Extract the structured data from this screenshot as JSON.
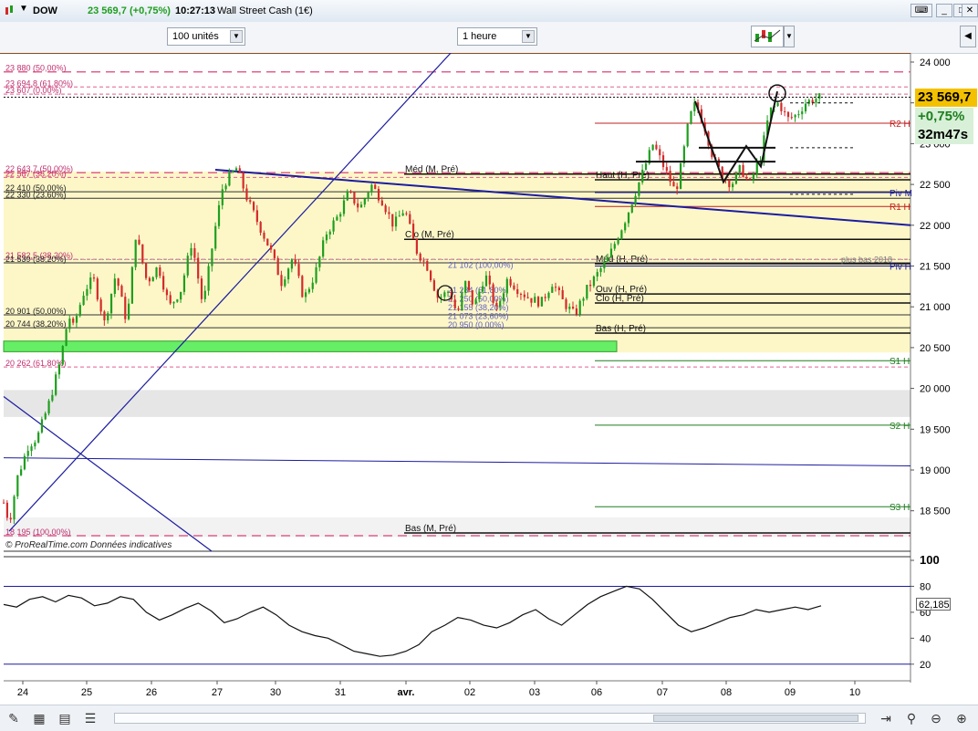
{
  "window": {
    "symbol": "DOW",
    "price": "23 569,7",
    "change": "(+0,75%)",
    "time": "10:27:13",
    "name": "Wall Street Cash (1€)"
  },
  "toolbar": {
    "units": "100 unités",
    "timeframe": "1 heure"
  },
  "badges": {
    "price": "23 569,7",
    "change": "+0,75%",
    "countdown": "32m47s"
  },
  "footer_note": "© ProRealTime.com  Données indicatives",
  "rsi_value": "62,185",
  "colors": {
    "up": "#1e9e1e",
    "down": "#d32a2a",
    "fib": "#e06090",
    "zone": "#fdf7c8",
    "trend": "#1c1ca0",
    "green_zone": "#66ee66"
  },
  "chart_data": [
    {
      "type": "candlestick",
      "title": "",
      "xlabel": "",
      "ylabel": "",
      "ylim": [
        18000,
        24200
      ],
      "grid": false,
      "x_tick_labels": [
        "24",
        "25",
        "26",
        "27",
        "30",
        "31",
        "avr.",
        "02",
        "03",
        "06",
        "07",
        "08",
        "09",
        "10"
      ],
      "y_tick_labels": [
        "24 000",
        "23 500",
        "23 000",
        "22 500",
        "22 000",
        "21 500",
        "21 000",
        "20 500",
        "20 000",
        "19 500",
        "19 000",
        "18 500"
      ],
      "y_ticks": [
        24000,
        23500,
        23000,
        22500,
        22000,
        21500,
        21000,
        20500,
        20000,
        19500,
        19000,
        18500
      ],
      "last_price": 23569.7,
      "path": [
        [
          0,
          18600
        ],
        [
          5,
          18350
        ],
        [
          12,
          18900
        ],
        [
          22,
          19300
        ],
        [
          30,
          19400
        ],
        [
          40,
          19800
        ],
        [
          50,
          20300
        ],
        [
          58,
          20900
        ],
        [
          62,
          20750
        ],
        [
          72,
          21200
        ],
        [
          80,
          21350
        ],
        [
          90,
          20800
        ],
        [
          100,
          21400
        ],
        [
          110,
          20800
        ],
        [
          118,
          21900
        ],
        [
          128,
          21300
        ],
        [
          138,
          21500
        ],
        [
          148,
          21000
        ],
        [
          158,
          21200
        ],
        [
          168,
          21800
        ],
        [
          178,
          21000
        ],
        [
          188,
          21900
        ],
        [
          196,
          22500
        ],
        [
          208,
          22700
        ],
        [
          218,
          22300
        ],
        [
          228,
          22000
        ],
        [
          238,
          21700
        ],
        [
          248,
          21300
        ],
        [
          258,
          21600
        ],
        [
          268,
          21100
        ],
        [
          278,
          21400
        ],
        [
          288,
          21900
        ],
        [
          298,
          22100
        ],
        [
          308,
          22400
        ],
        [
          318,
          22200
        ],
        [
          328,
          22500
        ],
        [
          338,
          22300
        ],
        [
          348,
          22000
        ],
        [
          358,
          22200
        ],
        [
          368,
          21700
        ],
        [
          378,
          21500
        ],
        [
          388,
          21100
        ],
        [
          398,
          21200
        ],
        [
          405,
          20900
        ],
        [
          412,
          21300
        ],
        [
          420,
          21000
        ],
        [
          430,
          21400
        ],
        [
          440,
          20950
        ],
        [
          450,
          21350
        ],
        [
          460,
          21200
        ],
        [
          470,
          21100
        ],
        [
          480,
          21050
        ],
        [
          490,
          21300
        ],
        [
          500,
          21050
        ],
        [
          510,
          20900
        ],
        [
          520,
          21200
        ],
        [
          530,
          21400
        ],
        [
          540,
          21600
        ],
        [
          548,
          21850
        ],
        [
          556,
          22100
        ],
        [
          564,
          22400
        ],
        [
          572,
          22700
        ],
        [
          580,
          23000
        ],
        [
          590,
          22700
        ],
        [
          600,
          22400
        ],
        [
          606,
          22800
        ],
        [
          612,
          23300
        ],
        [
          618,
          23500
        ],
        [
          626,
          23200
        ],
        [
          634,
          22800
        ],
        [
          642,
          22600
        ],
        [
          650,
          22500
        ],
        [
          658,
          22700
        ],
        [
          666,
          22500
        ],
        [
          676,
          22850
        ],
        [
          684,
          23400
        ],
        [
          692,
          23500
        ],
        [
          700,
          23300
        ],
        [
          708,
          23350
        ],
        [
          716,
          23500
        ],
        [
          724,
          23550
        ],
        [
          730,
          23570
        ]
      ],
      "price_levels": [
        {
          "label": "23 880 (50,00%)",
          "value": 23880,
          "style": "fib"
        },
        {
          "label": "23 694,8 (61,80%)",
          "value": 23695,
          "style": "fib-thin"
        },
        {
          "label": "23 607 (0,00%)",
          "value": 23607,
          "style": "fib-thin"
        },
        {
          "label": "22 643,7 (50,00%)",
          "value": 22644,
          "style": "fib"
        },
        {
          "label": "22 587 (38,20%)",
          "value": 22587,
          "style": "fib-thin"
        },
        {
          "label": "22 410 (50,00%)",
          "value": 22410,
          "style": "plain"
        },
        {
          "label": "22 330 (23,60%)",
          "value": 22330,
          "style": "plain"
        },
        {
          "label": "21 582,5 (38,20%)",
          "value": 21582,
          "style": "fib-thin"
        },
        {
          "label": "21 539 (38,20%)",
          "value": 21539,
          "style": "plain"
        },
        {
          "label": "20 901 (50,00%)",
          "value": 20901,
          "style": "plain"
        },
        {
          "label": "20 744 (38,20%)",
          "value": 20744,
          "style": "plain"
        },
        {
          "label": "20 262 (61,80%)",
          "value": 20262,
          "style": "fib-thin"
        },
        {
          "label": "18 195 (100,00%)",
          "value": 18195,
          "style": "fib"
        }
      ],
      "annotations": [
        {
          "label": "Méd (M, Pré)",
          "value": 22650
        },
        {
          "label": "Haut (H, Pré)",
          "value": 22580
        },
        {
          "label": "Clo (M, Pré)",
          "value": 21850
        },
        {
          "label": "Méd (H, Pré)",
          "value": 21550
        },
        {
          "label": "Ouv (H, Pré)",
          "value": 21180
        },
        {
          "label": "Clo (H, Pré)",
          "value": 21070
        },
        {
          "label": "Bas (H, Pré)",
          "value": 20700
        },
        {
          "label": "Bas (M, Pré)",
          "value": 18250
        }
      ],
      "pivot_labels": [
        "R2 H",
        "Piv M",
        "R1 H",
        "plus bas 2018",
        "Piv H",
        "S1 H",
        "S2 H",
        "S3 H"
      ],
      "fib_small": [
        "21 102 (100,00%)",
        "21 284 (61,80%)",
        "21 250 (50,00%)",
        "21 155 (38,20%)",
        "21 073 (23,60%)",
        "20 950 (0,00%)"
      ]
    },
    {
      "type": "line",
      "title": "",
      "series": [
        {
          "values": [
            66,
            64,
            70,
            72,
            68,
            73,
            71,
            65,
            67,
            72,
            70,
            60,
            54,
            58,
            63,
            67,
            61,
            52,
            55,
            60,
            64,
            58,
            50,
            45,
            42,
            40,
            35,
            30,
            28,
            26,
            27,
            30,
            35,
            45,
            50,
            56,
            54,
            50,
            48,
            52,
            58,
            62,
            55,
            50,
            58,
            66,
            72,
            76,
            80,
            78,
            70,
            60,
            50,
            45,
            48,
            52,
            56,
            58,
            62,
            60,
            62,
            64,
            62,
            65
          ]
        }
      ],
      "ylim": [
        10,
        100
      ],
      "y_tick_labels": [
        "100",
        "80",
        "60",
        "40",
        "20"
      ],
      "y_ticks": [
        100,
        80,
        60,
        40,
        20
      ],
      "last_value": 62.185
    }
  ]
}
